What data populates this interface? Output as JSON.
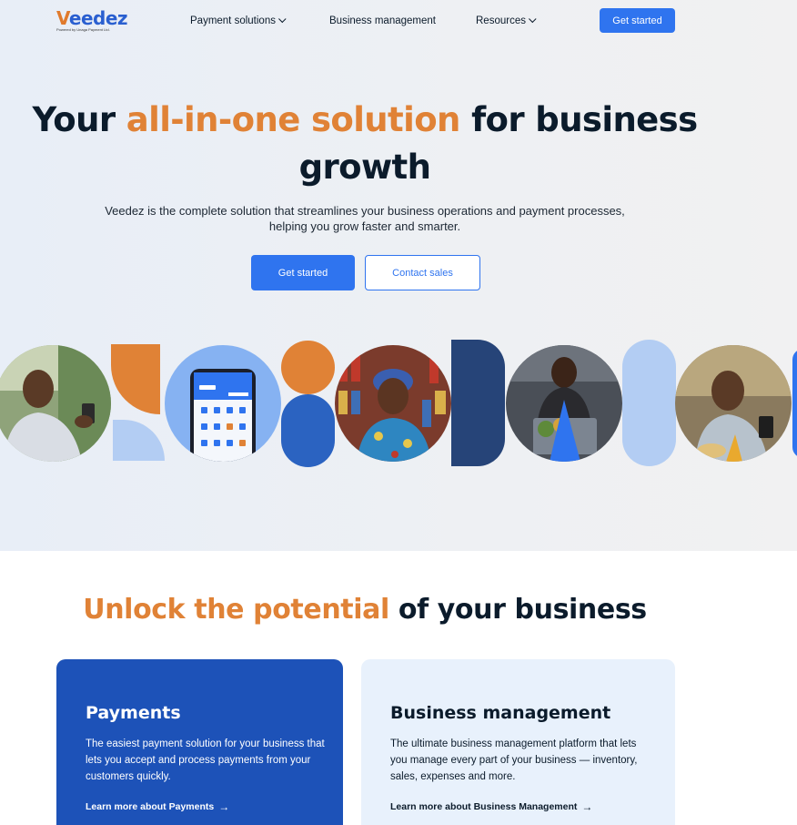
{
  "nav": {
    "logo_text": "eedez",
    "logo_letter": "V",
    "logo_tagline": "Powered by Unaga Payment Ltd.",
    "items": [
      {
        "label": "Payment solutions",
        "has_dropdown": true
      },
      {
        "label": "Business management",
        "has_dropdown": false
      },
      {
        "label": "Resources",
        "has_dropdown": true
      }
    ],
    "cta_label": "Get started"
  },
  "hero": {
    "title_part1": "Your ",
    "title_accent": "all-in-one solution",
    "title_part2": " for business growth",
    "lead": "Veedez is the complete solution that streamlines your business operations and payment processes, helping you grow faster and smarter.",
    "primary_button": "Get started",
    "secondary_button": "Contact sales"
  },
  "section2": {
    "title_accent": "Unlock the potential",
    "title_rest": " of your business",
    "cards": [
      {
        "title": "Payments",
        "description": "The easiest payment solution for your business that lets you accept and process payments from your customers quickly.",
        "link": "Learn more about Payments"
      },
      {
        "title": "Business management",
        "description": "The ultimate business management platform that lets you manage every part of your business — inventory, sales, expenses and more.",
        "link": "Learn more about Business Management"
      }
    ]
  },
  "colors": {
    "brand_blue": "#2f74ef",
    "accent_orange": "#e08236",
    "dark_blue": "#1d52b8",
    "navy": "#264478",
    "light_blue": "#b3cdf3"
  },
  "icons": {
    "dropdown": "chevron-down-icon",
    "link_arrow": "arrow-right-icon"
  }
}
